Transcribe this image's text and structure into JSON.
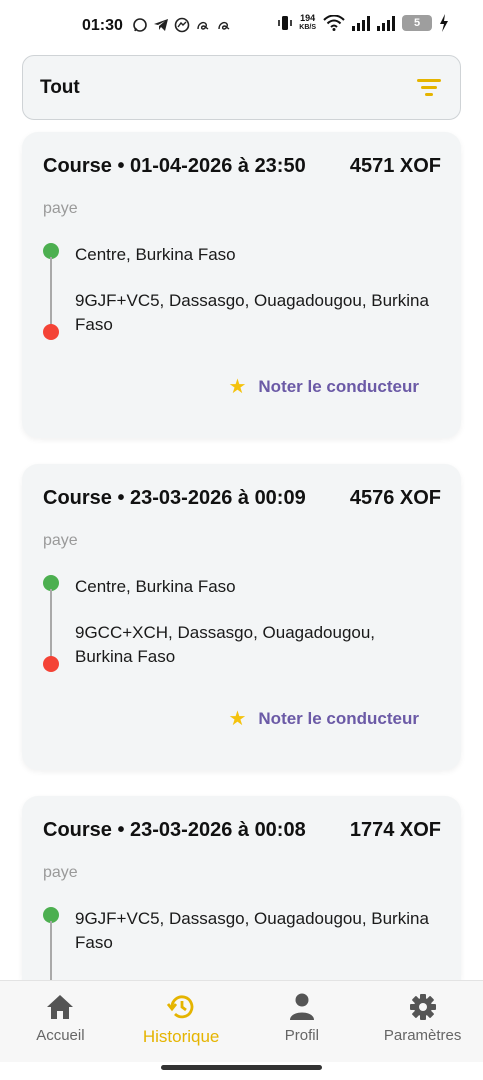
{
  "status_bar": {
    "time": "01:30",
    "net_speed_value": "194",
    "net_speed_unit": "KB/S",
    "battery_level": "5",
    "left_icons": [
      "whatsapp-icon",
      "telegram-icon",
      "messenger-icon",
      "script-a-icon",
      "script-a-icon"
    ]
  },
  "filter": {
    "label": "Tout",
    "icon": "filter-icon",
    "accent_color": "#e5b400"
  },
  "rides": [
    {
      "title": "Course • 01-04-2026 à 23:50",
      "price": "4571 XOF",
      "status": "paye",
      "pickup": "Centre, Burkina Faso",
      "dropoff": "9GJF+VC5, Dassasgo, Ouagadougou, Burkina Faso",
      "rate_label": "Noter le conducteur"
    },
    {
      "title": "Course • 23-03-2026 à 00:09",
      "price": "4576 XOF",
      "status": "paye",
      "pickup": "Centre, Burkina Faso",
      "dropoff": "9GCC+XCH, Dassasgo, Ouagadougou, Burkina Faso",
      "rate_label": "Noter le conducteur"
    },
    {
      "title": "Course • 23-03-2026 à 00:08",
      "price": "1774 XOF",
      "status": "paye",
      "pickup": "9GJF+VC5, Dassasgo, Ouagadougou, Burkina Faso"
    }
  ],
  "colors": {
    "pickup_dot": "#4caf50",
    "dropoff_dot": "#f44336",
    "rate_star": "#f4c20d",
    "rate_text": "#6b5aa6",
    "active_nav": "#e5b400"
  },
  "nav": {
    "items": [
      {
        "label": "Accueil",
        "icon": "home-icon"
      },
      {
        "label": "Historique",
        "icon": "history-icon"
      },
      {
        "label": "Profil",
        "icon": "person-icon"
      },
      {
        "label": "Paramètres",
        "icon": "gear-icon"
      }
    ],
    "active_index": 1
  }
}
